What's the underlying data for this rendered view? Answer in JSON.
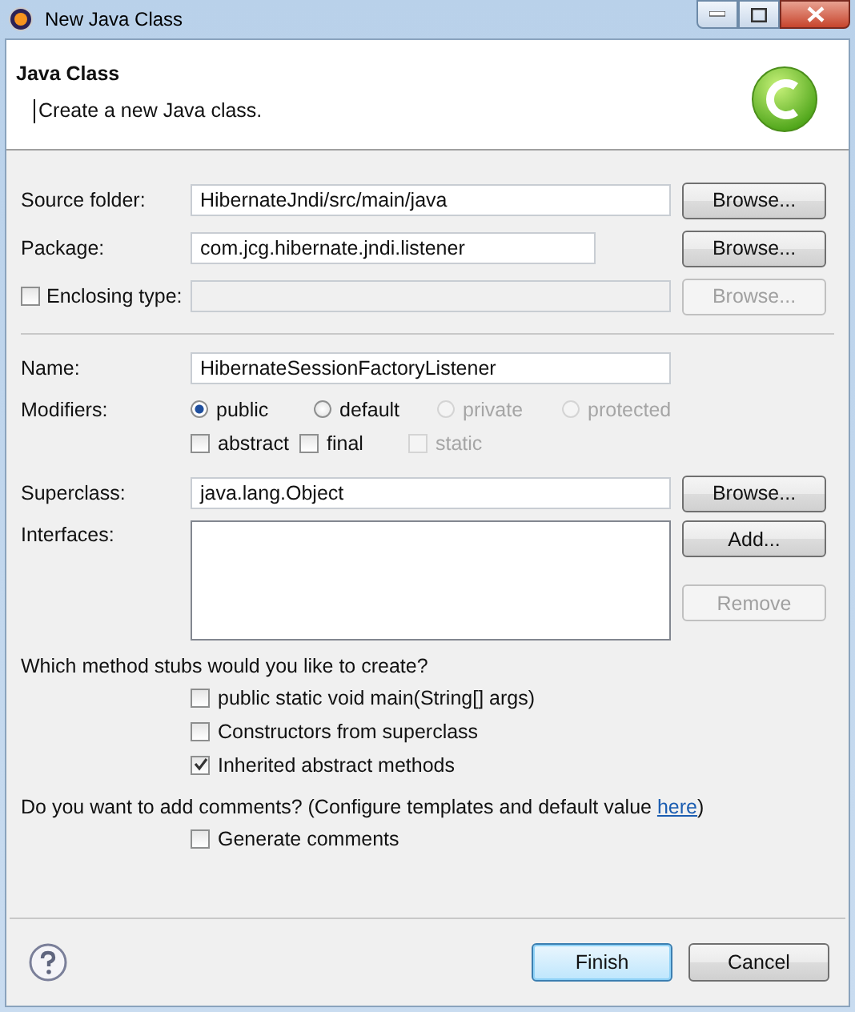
{
  "window": {
    "title": "New Java Class"
  },
  "header": {
    "title": "Java Class",
    "message": "Create a new Java class."
  },
  "source_folder": {
    "label": "Source folder:",
    "value": "HibernateJndi/src/main/java",
    "button": {
      "label": "Browse...",
      "disabled": false
    }
  },
  "package": {
    "label": "Package:",
    "value": "com.jcg.hibernate.jndi.listener",
    "button": {
      "label": "Browse...",
      "disabled": false
    }
  },
  "enclosing_type": {
    "label": "Enclosing type:",
    "checked": false,
    "disabled": true,
    "button": {
      "label": "Browse...",
      "disabled": true
    }
  },
  "name": {
    "label": "Name:",
    "value": "HibernateSessionFactoryListener"
  },
  "modifiers": {
    "label": "Modifiers:",
    "access": [
      {
        "label": "public",
        "selected": true,
        "disabled": false
      },
      {
        "label": "default",
        "selected": false,
        "disabled": false
      },
      {
        "label": "private",
        "selected": false,
        "disabled": true
      },
      {
        "label": "protected",
        "selected": false,
        "disabled": true
      }
    ],
    "flags": [
      {
        "label": "abstract",
        "checked": false,
        "disabled": false
      },
      {
        "label": "final",
        "checked": false,
        "disabled": false
      },
      {
        "label": "static",
        "checked": false,
        "disabled": true
      }
    ]
  },
  "superclass": {
    "label": "Superclass:",
    "value": "java.lang.Object",
    "button": {
      "label": "Browse...",
      "disabled": false
    }
  },
  "interfaces": {
    "label": "Interfaces:",
    "buttons": [
      {
        "label": "Add...",
        "disabled": false
      },
      {
        "label": "Remove",
        "disabled": true
      }
    ]
  },
  "method_stubs": {
    "question": "Which method stubs would you like to create?",
    "options": [
      {
        "label": "public static void main(String[] args)",
        "checked": false
      },
      {
        "label": "Constructors from superclass",
        "checked": false
      },
      {
        "label": "Inherited abstract methods",
        "checked": true
      }
    ]
  },
  "comments": {
    "question": "Do you want to add comments? (Configure templates and default value",
    "link": "here",
    "closing": ")",
    "options": [
      {
        "label": "Generate comments",
        "checked": false
      }
    ]
  },
  "footer": {
    "buttons": [
      {
        "label": "Finish",
        "default": true
      },
      {
        "label": "Cancel",
        "default": false
      }
    ]
  }
}
